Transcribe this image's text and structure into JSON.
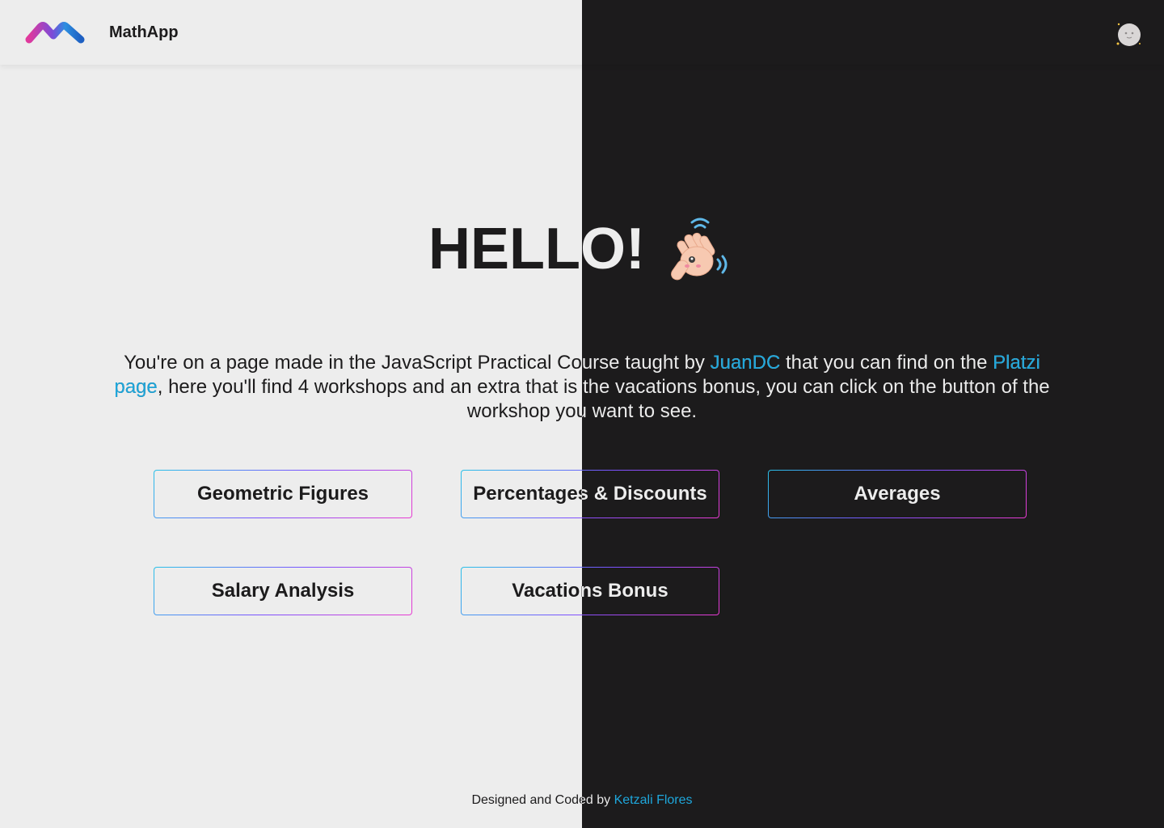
{
  "header": {
    "brand": "MathApp",
    "logo_icon": "mathapp-logo-icon",
    "theme_toggle_icon": "moon-icon"
  },
  "hero": {
    "title": "HELLO!",
    "emoji_icon": "waving-hand-icon"
  },
  "intro": {
    "part1": "You're on a page made in the JavaScript Practical Course taught by ",
    "link1": "JuanDC",
    "part2": " that you can find on the ",
    "link2": "Platzi page",
    "part3": ", here you'll find 4 workshops and an extra that is the vacations bonus, you can click on the button of the workshop you want to see."
  },
  "buttons": [
    {
      "label": "Geometric Figures"
    },
    {
      "label": "Percentages & Discounts"
    },
    {
      "label": "Averages"
    },
    {
      "label": "Salary Analysis"
    },
    {
      "label": "Vacations Bonus"
    }
  ],
  "footer": {
    "text": "Designed and Coded by ",
    "author": "Ketzali Flores"
  },
  "colors": {
    "light_bg": "#ededed",
    "dark_bg": "#1c1b1c",
    "link": "#1ea7dc",
    "gradient_start": "#29c1e8",
    "gradient_mid": "#7a52ff",
    "gradient_end": "#e93bd1"
  }
}
